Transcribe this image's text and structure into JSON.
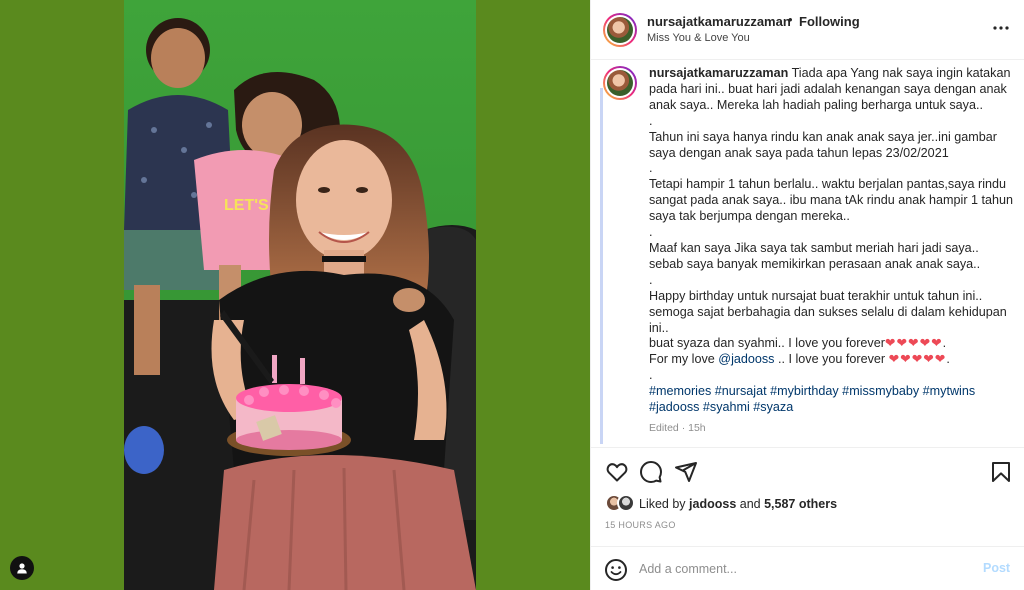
{
  "post": {
    "username": "nursajatkamaruzzaman",
    "follow_status": "Following",
    "separator": "•",
    "subtitle": "Miss You & Love You"
  },
  "caption": {
    "username": "nursajatkamaruzzaman",
    "p1": " Tiada apa Yang nak saya ingin katakan pada hari ini.. buat hari jadi adalah kenangan saya dengan anak anak saya.. Mereka lah hadiah paling berharga untuk saya..",
    "dot1": ".",
    "p2": "Tahun ini saya hanya rindu kan anak anak saya jer..ini gambar saya dengan anak saya pada tahun lepas 23/02/2021",
    "dot2": ".",
    "p3": "Tetapi hampir 1 tahun berlalu.. waktu berjalan pantas,saya rindu sangat pada anak saya.. ibu mana tAk rindu anak hampir 1 tahun saya tak berjumpa dengan mereka..",
    "dot3": ".",
    "p4": "Maaf kan saya Jika saya tak sambut meriah hari jadi saya.. sebab saya banyak memikirkan perasaan anak anak saya..",
    "dot4": ".",
    "p5": "Happy birthday untuk nursajat buat terakhir untuk tahun ini.. semoga sajat berbahagia dan sukses selalu di dalam kehidupan ini..",
    "line_love_prefix": "buat syaza dan syahmi.. I love you forever",
    "hearts1": "❤❤❤❤❤",
    "line_love_suffix": ".",
    "line_for_prefix": "For my love ",
    "mention": "@jadooss",
    "line_for_mid": " .. I love you forever ",
    "hearts2": "❤❤❤❤❤",
    "line_for_suffix": ".",
    "dot5": ".",
    "hashtags_line1": "#memories #nursajat #mybirthday #missmybaby #mytwins",
    "hashtags_line2": "#jadooss #syahmi #syaza",
    "meta": "Edited · 15h"
  },
  "likes": {
    "prefix": "Liked by ",
    "user": "jadooss",
    "and": " and ",
    "count": "5,587 others"
  },
  "time_ago": "15 HOURS AGO",
  "comment": {
    "placeholder": "Add a comment...",
    "post_label": "Post"
  },
  "icons": {
    "more": "more-options-icon",
    "like": "heart-icon",
    "comment": "comment-icon",
    "share": "share-icon",
    "save": "bookmark-icon",
    "emoji": "emoji-icon",
    "user_tags": "user-icon"
  },
  "colors": {
    "media_background": "#5a8a1e",
    "link": "#00376b",
    "muted": "#8e8e8e",
    "heart": "#ed4956",
    "post_button_disabled": "#b3dbff"
  }
}
